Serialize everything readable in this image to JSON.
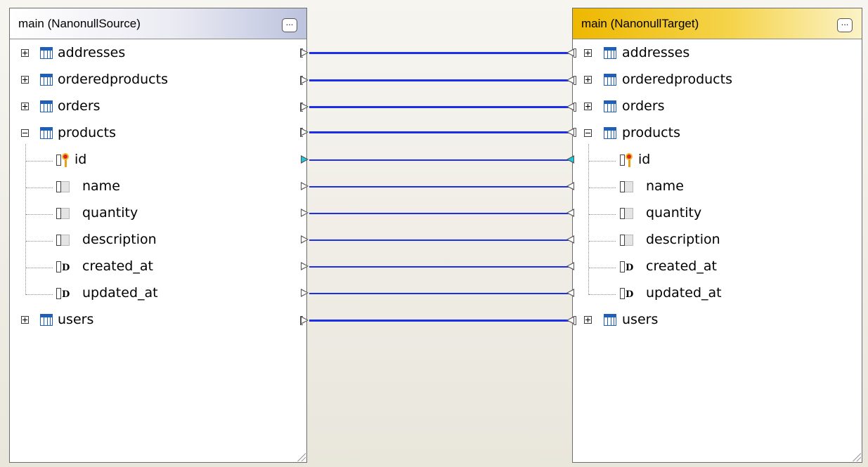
{
  "source": {
    "title": "main (NanonullSource)",
    "menu_label": "..."
  },
  "target": {
    "title": "main (NanonullTarget)",
    "menu_label": "..."
  },
  "tables": {
    "addresses": "addresses",
    "orderedproducts": "orderedproducts",
    "orders": "orders",
    "products": "products",
    "users": "users"
  },
  "columns": {
    "id": "id",
    "name": "name",
    "quantity": "quantity",
    "description": "description",
    "created_at": "created_at",
    "updated_at": "updated_at"
  },
  "colors": {
    "mapping_line": "#1d2ee8",
    "key_connector": "#1cc8d8",
    "table_icon": "#1f5fb8",
    "target_header": "#eeb800",
    "source_header": "#bcc3de"
  }
}
